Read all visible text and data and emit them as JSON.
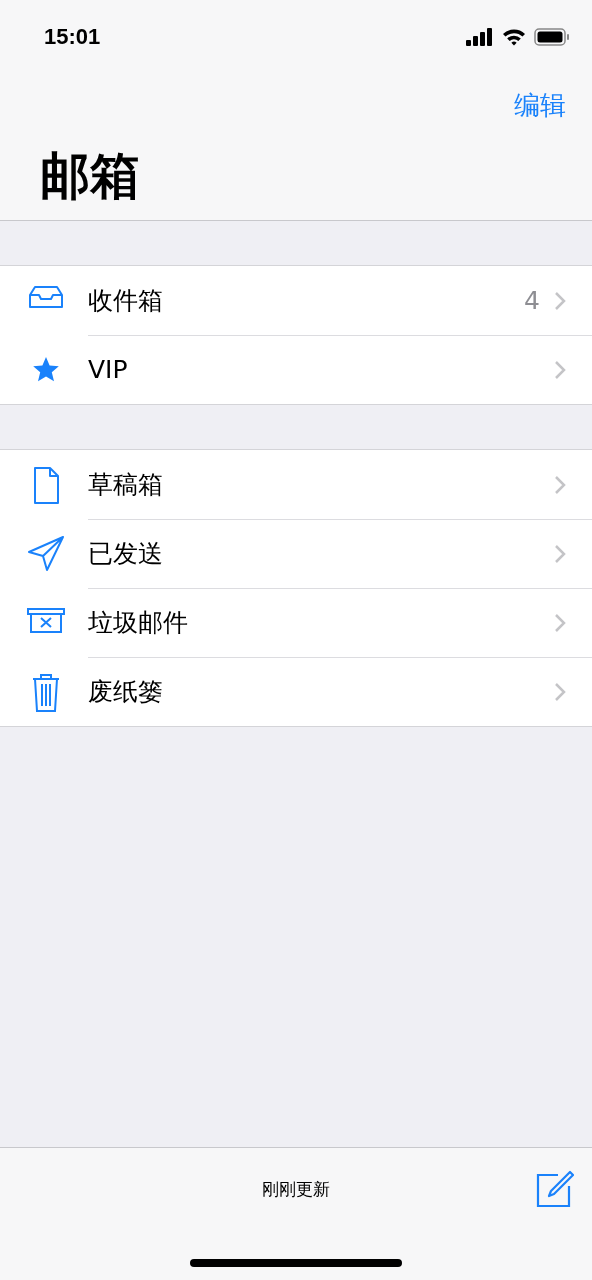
{
  "status_bar": {
    "time": "15:01"
  },
  "nav": {
    "edit": "编辑",
    "title": "邮箱"
  },
  "sections": [
    {
      "rows": [
        {
          "kind": "inbox",
          "label": "收件箱",
          "count": "4"
        },
        {
          "kind": "vip",
          "label": "VIP"
        }
      ]
    },
    {
      "rows": [
        {
          "kind": "drafts",
          "label": "草稿箱"
        },
        {
          "kind": "sent",
          "label": "已发送"
        },
        {
          "kind": "junk",
          "label": "垃圾邮件"
        },
        {
          "kind": "trash",
          "label": "废纸篓"
        }
      ]
    }
  ],
  "toolbar": {
    "status": "刚刚更新"
  }
}
